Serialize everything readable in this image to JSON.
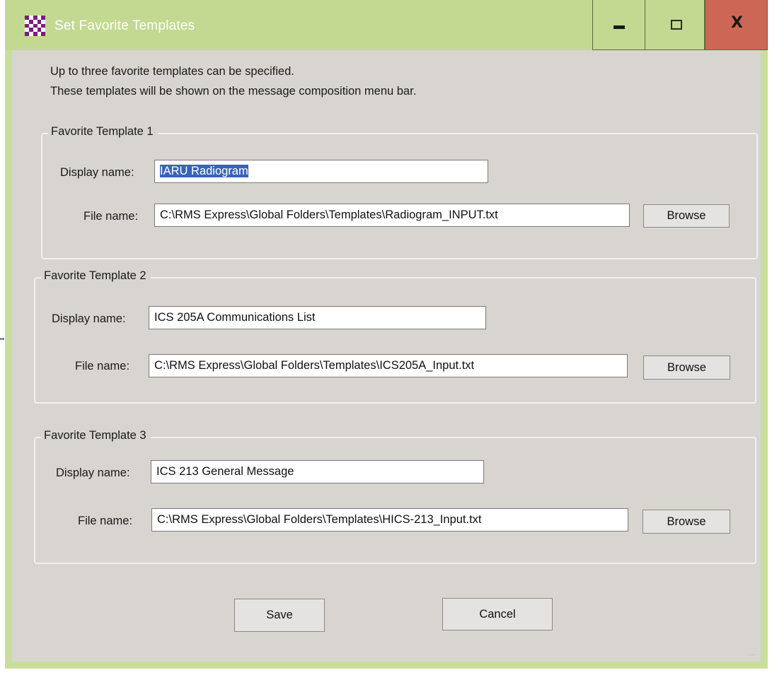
{
  "window": {
    "title": "Set Favorite Templates",
    "app_icon": "checkered-app-icon",
    "controls": {
      "minimize_icon": "minimize-icon",
      "maximize_icon": "maximize-icon",
      "close_icon": "close-icon",
      "close_glyph": "X"
    },
    "colors": {
      "titlebar": "#c3d991",
      "close_button": "#cd6755",
      "client_background": "#d8d5d0"
    }
  },
  "intro": {
    "line1": "Up to three favorite templates can be specified.",
    "line2": "These templates will be shown on the message composition menu bar."
  },
  "groups": [
    {
      "title": "Favorite Template 1",
      "display_label": "Display name:",
      "display_value": "IARU Radiogram",
      "file_label": "File name:",
      "file_value": "C:\\RMS Express\\Global Folders\\Templates\\Radiogram_INPUT.txt",
      "browse_label": "Browse"
    },
    {
      "title": "Favorite Template 2",
      "display_label": "Display name:",
      "display_value": "ICS 205A Communications List",
      "file_label": "File name:",
      "file_value": "C:\\RMS Express\\Global Folders\\Templates\\ICS205A_Input.txt",
      "browse_label": "Browse"
    },
    {
      "title": "Favorite Template 3",
      "display_label": "Display name:",
      "display_value": "ICS 213 General Message",
      "file_label": "File name:",
      "file_value": "C:\\RMS Express\\Global Folders\\Templates\\HICS-213_Input.txt",
      "browse_label": "Browse"
    }
  ],
  "buttons": {
    "save": "Save",
    "cancel": "Cancel"
  }
}
